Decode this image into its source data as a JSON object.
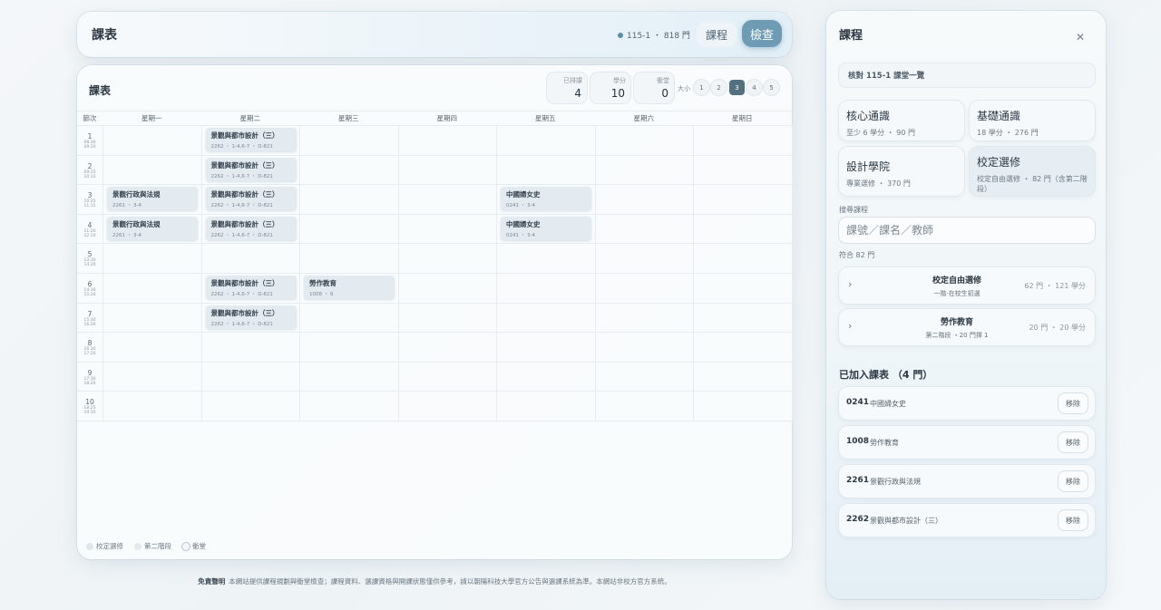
{
  "header": {
    "title": "課表",
    "semester_info": "115-1 ・ 818 門",
    "course_button": "課程",
    "check_button": "檢查"
  },
  "timetable": {
    "title": "課表",
    "stats": [
      {
        "label": "已排課",
        "value": "4"
      },
      {
        "label": "學分",
        "value": "10"
      },
      {
        "label": "衝堂",
        "value": "0"
      }
    ],
    "size_label": "大小",
    "size_pages": [
      "1",
      "2",
      "3",
      "4",
      "5"
    ],
    "active_size": "3",
    "col_period": "節次",
    "days": [
      "星期一",
      "星期二",
      "星期三",
      "星期四",
      "星期五",
      "星期六",
      "星期日"
    ],
    "periods": [
      {
        "n": "1",
        "s": "08:30",
        "e": "09:20"
      },
      {
        "n": "2",
        "s": "09:25",
        "e": "10:15"
      },
      {
        "n": "3",
        "s": "10:25",
        "e": "11:15"
      },
      {
        "n": "4",
        "s": "11:20",
        "e": "12:10"
      },
      {
        "n": "5",
        "s": "13:30",
        "e": "14:20"
      },
      {
        "n": "6",
        "s": "14:30",
        "e": "15:20"
      },
      {
        "n": "7",
        "s": "15:30",
        "e": "16:20"
      },
      {
        "n": "8",
        "s": "16:30",
        "e": "17:20"
      },
      {
        "n": "9",
        "s": "17:30",
        "e": "18:20"
      },
      {
        "n": "10",
        "s": "18:25",
        "e": "19:10"
      }
    ],
    "entries": [
      {
        "day": 1,
        "period": 1,
        "name": "景觀與都市設計（三）",
        "detail": "2262 ・ 1-4,6-7 ・ D-821"
      },
      {
        "day": 1,
        "period": 2,
        "name": "景觀與都市設計（三）",
        "detail": "2262 ・ 1-4,6-7 ・ D-821"
      },
      {
        "day": 1,
        "period": 3,
        "name": "景觀與都市設計（三）",
        "detail": "2262 ・ 1-4,6-7 ・ D-821"
      },
      {
        "day": 1,
        "period": 4,
        "name": "景觀與都市設計（三）",
        "detail": "2262 ・ 1-4,6-7 ・ D-821"
      },
      {
        "day": 1,
        "period": 6,
        "name": "景觀與都市設計（三）",
        "detail": "2262 ・ 1-4,6-7 ・ D-821"
      },
      {
        "day": 1,
        "period": 7,
        "name": "景觀與都市設計（三）",
        "detail": "2262 ・ 1-4,6-7 ・ D-821"
      },
      {
        "day": 0,
        "period": 3,
        "name": "景觀行政與法規",
        "detail": "2261 ・ 3-4"
      },
      {
        "day": 0,
        "period": 4,
        "name": "景觀行政與法規",
        "detail": "2261 ・ 3-4"
      },
      {
        "day": 4,
        "period": 3,
        "name": "中國婦女史",
        "detail": "0241 ・ 3-4"
      },
      {
        "day": 4,
        "period": 4,
        "name": "中國婦女史",
        "detail": "0241 ・ 3-4"
      },
      {
        "day": 2,
        "period": 6,
        "name": "勞作教育",
        "detail": "1008 ・ 6"
      }
    ],
    "legend": [
      {
        "label": "校定選修",
        "color": "#dfe7ec"
      },
      {
        "label": "第二階段",
        "color": "#e3e9ed"
      },
      {
        "label": "衝堂",
        "color": "#f4f7f9"
      }
    ]
  },
  "footer": {
    "label": "免責聲明",
    "text": "本網站提供課程規劃與衝堂檢查；課程資料、選課資格與開課狀態僅供參考，請以朝陽科技大學官方公告與選課系統為準。本網站非校方官方系統。"
  },
  "panel": {
    "title": "課程",
    "subheader": "核對 115-1 課堂一覽",
    "categories": [
      {
        "name": "核心通識",
        "desc": "至少 6 學分 ・ 90 門"
      },
      {
        "name": "基礎通識",
        "desc": "18 學分 ・ 276 門"
      },
      {
        "name": "設計學院",
        "desc": "專業選修 ・ 370 門"
      },
      {
        "name": "校定選修",
        "desc": "校定自由選修 ・ 82 門（含第二階段）"
      }
    ],
    "search_label": "搜尋課程",
    "search_placeholder": "課號／課名／教師",
    "match_text": "符合 82 門",
    "groups": [
      {
        "name": "校定自由選修",
        "desc": "一階·在校生初選",
        "count": "62 門 ・ 121 學分"
      },
      {
        "name": "勞作教育",
        "desc": "第二階段 ・20 門擇 1",
        "count": "20 門 ・ 20 學分"
      }
    ],
    "added_title": "已加入課表 （4 門）",
    "added": [
      {
        "code": "0241",
        "name": "中國婦女史",
        "remove": "移除"
      },
      {
        "code": "1008",
        "name": "勞作教育",
        "remove": "移除"
      },
      {
        "code": "2261",
        "name": "景觀行政與法規",
        "remove": "移除"
      },
      {
        "code": "2262",
        "name": "景觀與都市設計（三）",
        "remove": "移除"
      }
    ]
  }
}
